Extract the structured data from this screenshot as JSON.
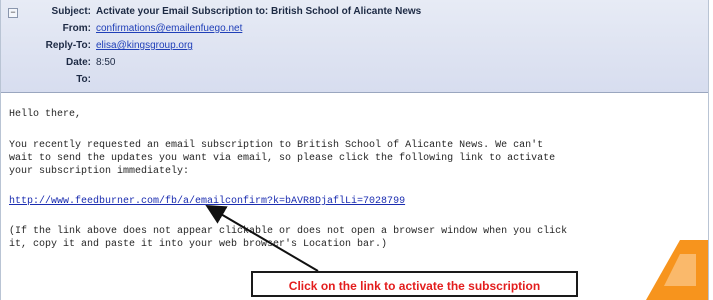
{
  "email": {
    "header": {
      "subject_label": "Subject:",
      "subject": "Activate your Email Subscription to: British School of Alicante News",
      "from_label": "From:",
      "from": "confirmations@emailenfuego.net",
      "reply_to_label": "Reply-To:",
      "reply_to": "elisa@kingsgroup.org",
      "date_label": "Date:",
      "date": "8:50",
      "to_label": "To:",
      "to": ""
    },
    "body": {
      "greeting": "Hello there,",
      "paragraph_lines": [
        "You recently requested an email subscription to British School of Alicante News. We can't",
        "wait to send the updates you want via email, so please click the following link to activate",
        "your subscription immediately:"
      ],
      "confirm_link": "http://www.feedburner.com/fb/a/emailconfirm?k=bAVR8DjaflLi=7028799",
      "note_lines": [
        "(If the link above does not appear clickable or does not open a browser window when you click",
        "it, copy it and paste it into your web browser's Location bar.)"
      ]
    }
  },
  "annotation": {
    "callout_text": "Click on the link to activate the subscription",
    "callout_color": "#e31d1d"
  },
  "colors": {
    "header_bg": "#dde2f1",
    "link": "#1a2cb0",
    "logo_orange": "#f7941d"
  }
}
